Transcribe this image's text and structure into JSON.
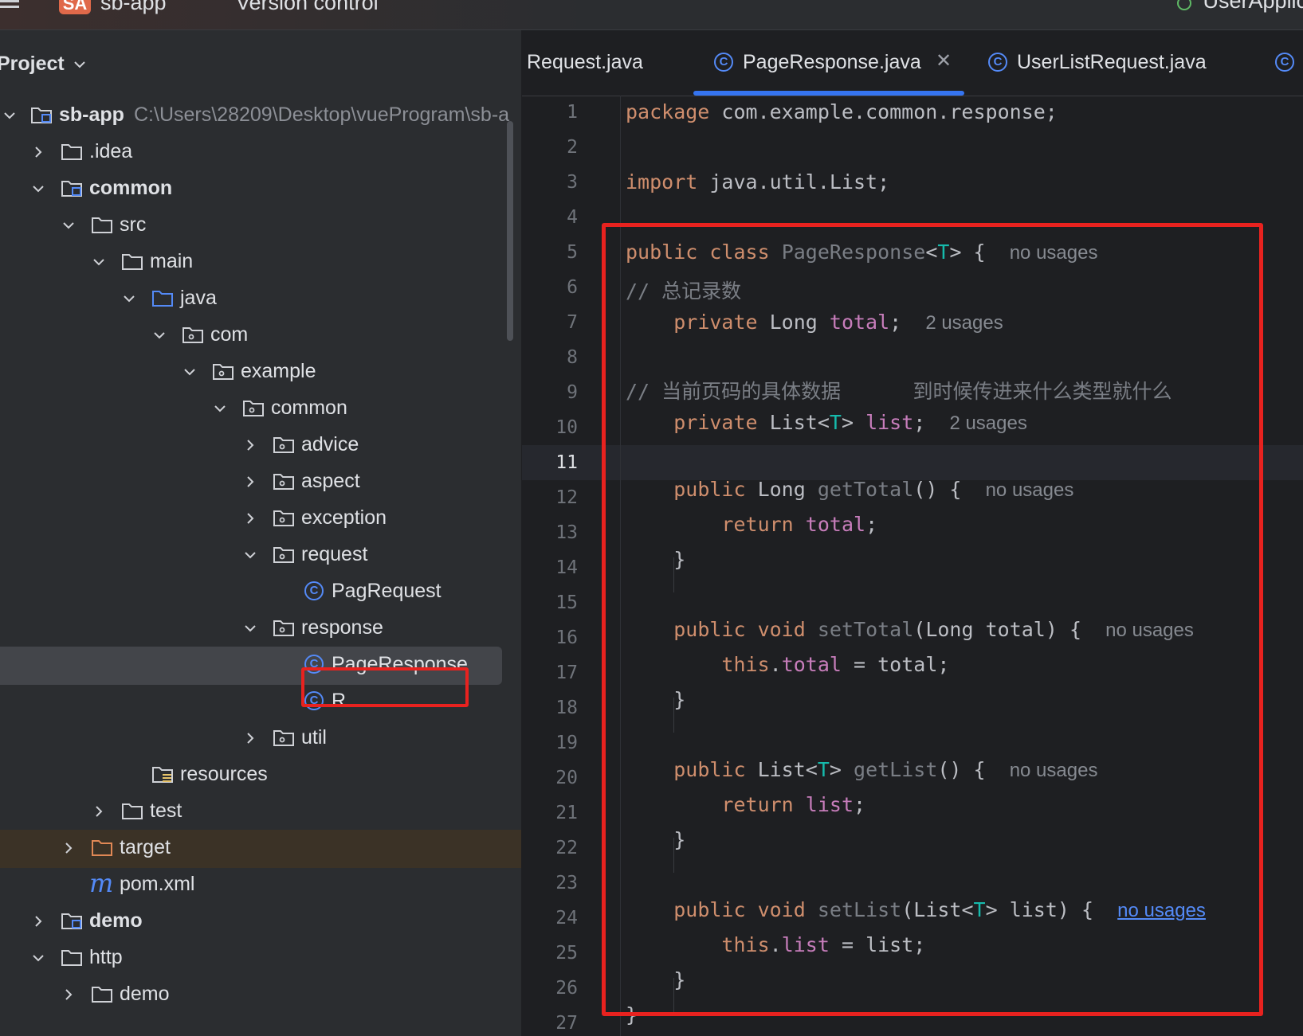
{
  "topbar": {
    "project_badge": "SA",
    "project_name": "sb-app",
    "version_control": "Version control",
    "run_config": "UserApplic"
  },
  "sidebar": {
    "title": "Project",
    "root": {
      "name": "sb-app",
      "path": "C:\\Users\\28209\\Desktop\\vueProgram\\sb-a"
    },
    "items": [
      {
        "label": ".idea"
      },
      {
        "label": "common"
      },
      {
        "label": "src"
      },
      {
        "label": "main"
      },
      {
        "label": "java"
      },
      {
        "label": "com"
      },
      {
        "label": "example"
      },
      {
        "label": "common"
      },
      {
        "label": "advice"
      },
      {
        "label": "aspect"
      },
      {
        "label": "exception"
      },
      {
        "label": "request"
      },
      {
        "label": "PagRequest"
      },
      {
        "label": "response"
      },
      {
        "label": "PageResponse"
      },
      {
        "label": "R"
      },
      {
        "label": "util"
      },
      {
        "label": "resources"
      },
      {
        "label": "test"
      },
      {
        "label": "target"
      },
      {
        "label": "pom.xml"
      },
      {
        "label": "demo"
      },
      {
        "label": "http"
      },
      {
        "label": "demo"
      }
    ]
  },
  "tabs": [
    {
      "label": "Request.java"
    },
    {
      "label": "PageResponse.java"
    },
    {
      "label": "UserListRequest.java"
    }
  ],
  "editor": {
    "line_numbers": [
      "1",
      "2",
      "3",
      "4",
      "5",
      "6",
      "7",
      "8",
      "9",
      "10",
      "11",
      "12",
      "13",
      "14",
      "15",
      "16",
      "17",
      "18",
      "19",
      "20",
      "21",
      "22",
      "23",
      "24",
      "25",
      "26",
      "27"
    ],
    "hints": {
      "no_usages": "no usages",
      "two_usages": "2 usages"
    },
    "comments": {
      "total": "// 总记录数",
      "list": "// 当前页码的具体数据      到时候传进来什么类型就什么"
    }
  },
  "colors": {
    "highlight_box": "#e8221f",
    "accent": "#3574f0",
    "keyword": "#cf8e6d",
    "field": "#c77dbb",
    "type_param": "#16baac"
  }
}
